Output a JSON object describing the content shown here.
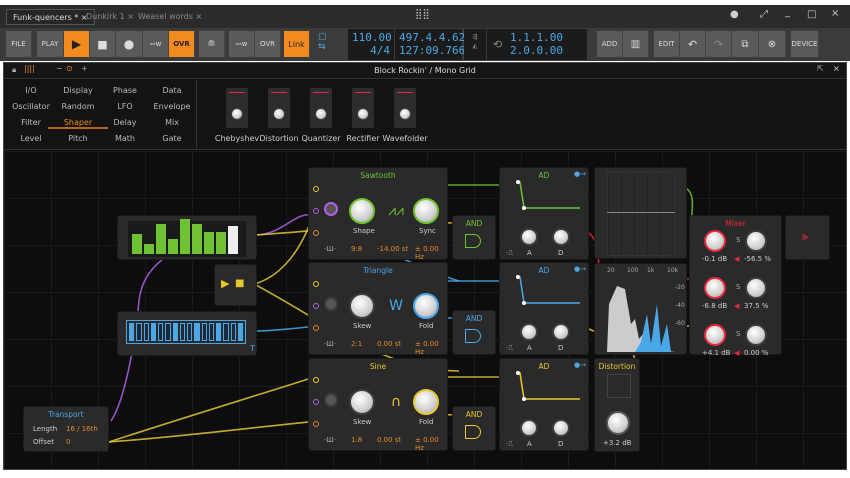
{
  "tabs": [
    {
      "label": "Funk-quencers *"
    },
    {
      "label": "Dunkirk 1"
    },
    {
      "label": "Weasel words"
    }
  ],
  "toolbar": {
    "file": "FILE",
    "play": "PLAY",
    "ovr": "OVR",
    "ovr2": "OVR",
    "link": "Link",
    "tempo": "110.00",
    "signature": "4/4",
    "position": "497.4.4.62",
    "time": "127:09.766",
    "loop_start": "1.1.1.00",
    "loop_length": "2.0.0.00",
    "add": "ADD",
    "edit": "EDIT",
    "device": "DEVICE"
  },
  "device": {
    "title": "Block Rockin' / Mono Grid"
  },
  "browser": {
    "categories": [
      "I/O",
      "Display",
      "Phase",
      "Data",
      "Oscillator",
      "Random",
      "LFO",
      "Envelope",
      "Filter",
      "Shaper",
      "Delay",
      "Mix",
      "Level",
      "Pitch",
      "Math",
      "Gate"
    ],
    "selected": "Shaper",
    "previews": [
      "Chebyshev",
      "Distortion",
      "Quantizer",
      "Rectifier",
      "Wavefolder"
    ]
  },
  "modules": {
    "transport": {
      "title": "Transport",
      "length_label": "Length",
      "length": "16 / 16th",
      "offset_label": "Offset",
      "offset": "0"
    },
    "saw": {
      "title": "Sawtooth",
      "k1": "Shape",
      "k2": "Sync",
      "ratio": "9:8",
      "pitch": "-14.00 st",
      "hz": "± 0.00 Hz"
    },
    "tri": {
      "title": "Triangle",
      "k1": "Skew",
      "k2": "Fold",
      "ratio": "2:1",
      "pitch": "0.00 st",
      "hz": "± 0.00 Hz"
    },
    "sine": {
      "title": "Sine",
      "k1": "Skew",
      "k2": "Fold",
      "ratio": "1:8",
      "pitch": "0.00 st",
      "hz": "± 0.00 Hz"
    },
    "and": "AND",
    "ad": {
      "title": "AD",
      "a": "A",
      "d": "D"
    },
    "spectrum": {
      "labels": [
        "20",
        "100",
        "1k",
        "10k"
      ],
      "db": [
        "-20",
        "-40",
        "-60"
      ]
    },
    "distortion": {
      "title": "Distortion",
      "value": "+3.2 dB"
    },
    "mixer": {
      "title": "Mixer",
      "s": "S",
      "rows": [
        {
          "gain": "-0.1 dB",
          "pan": "-56.5 %"
        },
        {
          "gain": "-6.8 dB",
          "pan": "37.5 %"
        },
        {
          "gain": "+4.1 dB",
          "pan": "0.00 %"
        }
      ]
    }
  },
  "colors": {
    "accent": "#f28a1e",
    "green": "#6fc232",
    "blue": "#4aa8e8",
    "yellow": "#e8c830",
    "red": "#e8283c",
    "purple": "#b060e8"
  }
}
